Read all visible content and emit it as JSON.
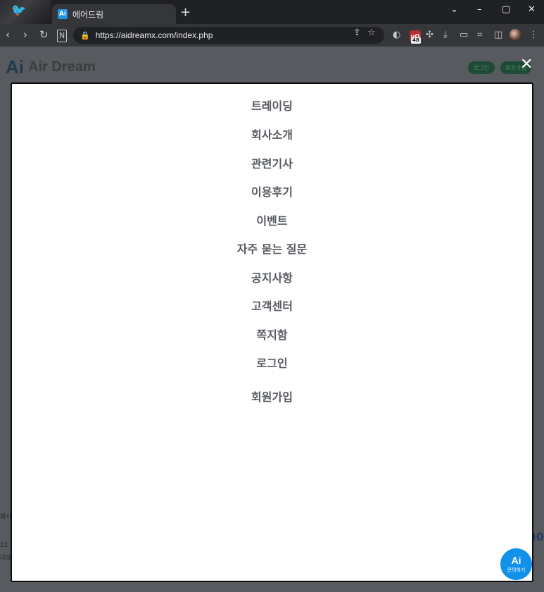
{
  "browser": {
    "tab_title": "에어드림",
    "new_tab_glyph": "+",
    "url": "https://aidreamx.com/index.php",
    "extension_badge": "48",
    "window_controls": [
      "⌄",
      "–",
      "▢",
      "✕"
    ]
  },
  "site": {
    "logo_text": "Air Dream",
    "header_buttons": [
      "로그인",
      "회원가입"
    ],
    "close_glyph": "✕",
    "bg_fragments": [
      "회사",
      "12",
      "대표",
      ")0"
    ]
  },
  "menu": {
    "items": [
      "트레이딩",
      "회사소개",
      "관련기사",
      "이용후기",
      "이벤트",
      "자주 묻는 질문",
      "공지사항",
      "고객센터",
      "쪽지함",
      "로그인",
      "회원가입"
    ]
  },
  "chat": {
    "label": "문의하기"
  },
  "colors": {
    "accent": "#1390e9",
    "menu_text": "#565a61",
    "overlay": "#575a5e"
  }
}
